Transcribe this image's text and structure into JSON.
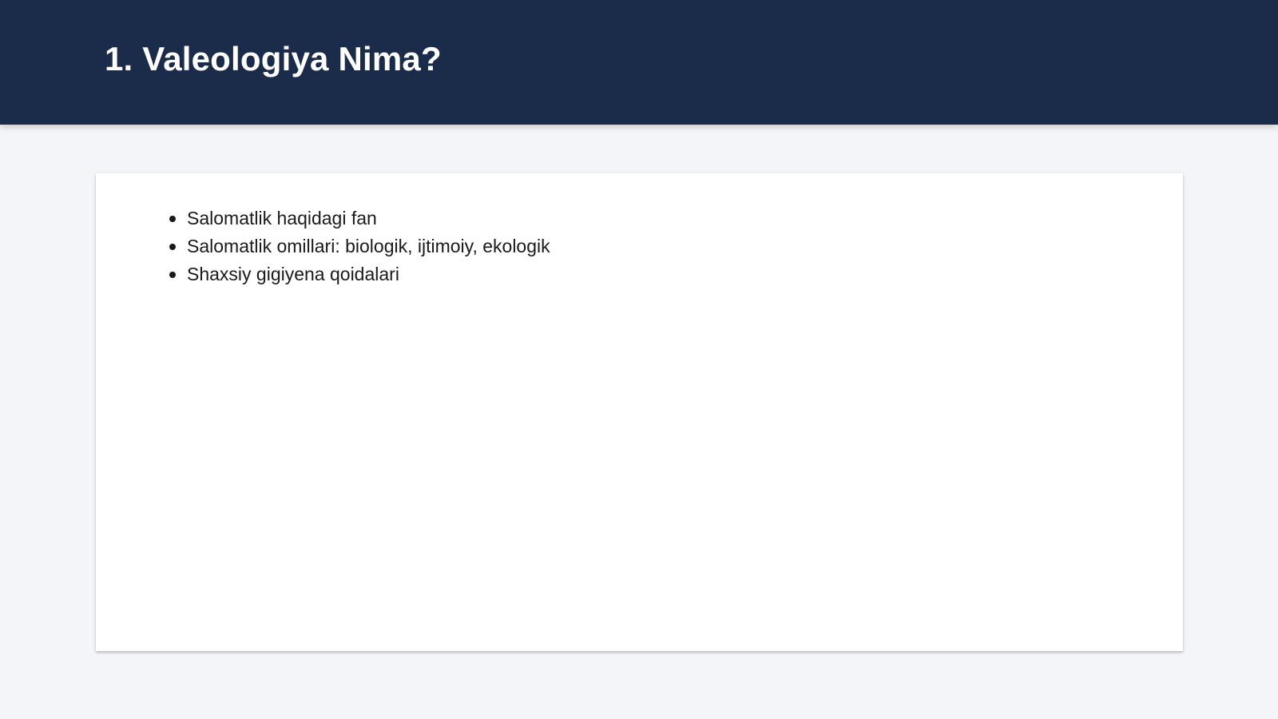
{
  "slide": {
    "title": "1. Valeologiya Nima?",
    "bullets": [
      "Salomatlik haqidagi fan",
      "Salomatlik omillari: biologik, ijtimoiy, ekologik",
      "Shaxsiy gigiyena qoidalari"
    ]
  },
  "colors": {
    "header_background": "#1b2b4a",
    "page_background": "#f3f5f8",
    "card_background": "#ffffff",
    "title_text": "#ffffff",
    "body_text": "#1a1a1a"
  }
}
